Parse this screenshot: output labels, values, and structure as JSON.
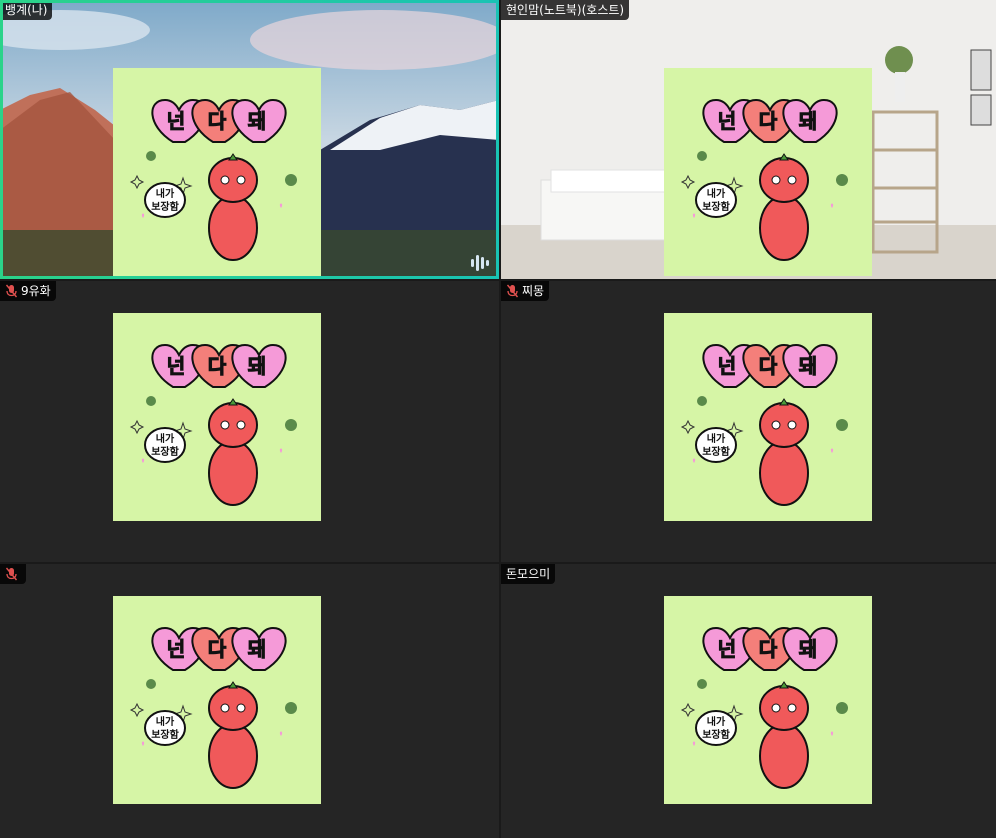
{
  "participants": [
    {
      "name": "뱅계(나)",
      "muted": false,
      "active_speaker": true,
      "background": "mountains"
    },
    {
      "name": "현인맘(노트북)(호스트)",
      "muted": false,
      "active_speaker": false,
      "background": "living-room"
    },
    {
      "name": "9유화",
      "muted": true,
      "active_speaker": false,
      "background": "dark"
    },
    {
      "name": "찌몽",
      "muted": true,
      "active_speaker": false,
      "background": "dark"
    },
    {
      "name": "",
      "muted": true,
      "active_speaker": false,
      "background": "dark"
    },
    {
      "name": "돈모으미",
      "muted": false,
      "active_speaker": false,
      "background": "dark"
    }
  ],
  "sticker": {
    "headline": [
      "넌",
      "다",
      "돼"
    ],
    "bubble_line1": "내가",
    "bubble_line2": "보장함"
  },
  "colors": {
    "active_border": "#2bd38a",
    "card_bg": "#d6f5a6",
    "heart_pink": "#f59ad8",
    "heart_coral": "#f47f7a",
    "character_red": "#f0595a"
  },
  "icons": {
    "mic_off": "mic-off-icon",
    "audio_level": "audio-level-icon"
  }
}
